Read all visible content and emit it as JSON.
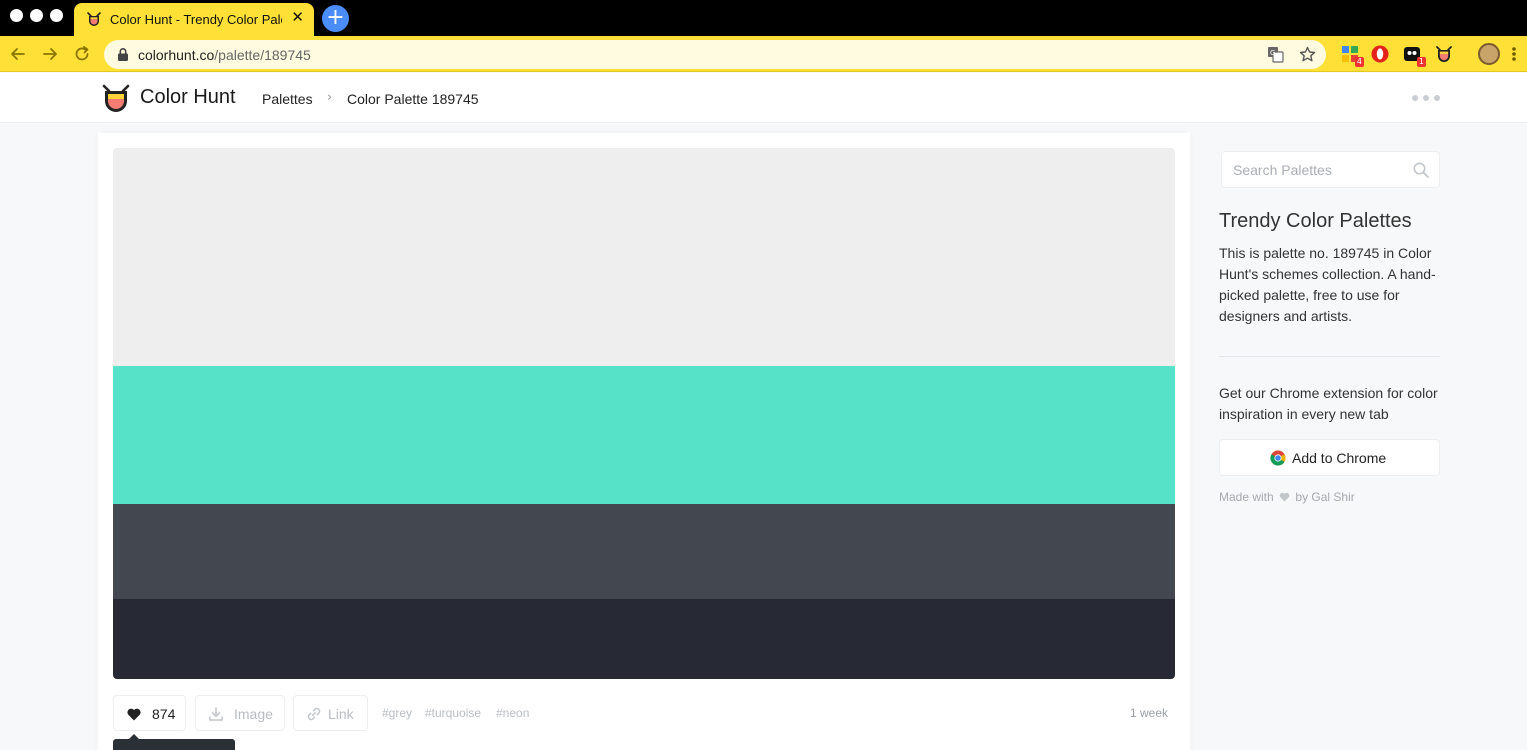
{
  "browser": {
    "tab_title": "Color Hunt - Trendy Color Palettes",
    "tab_close": "✕",
    "new_tab": "+",
    "url_host": "colorhunt.co",
    "url_path": "/palette/189745",
    "extensions": [
      {
        "name": "extension-1",
        "badge": "4"
      },
      {
        "name": "opera-adblock",
        "badge": ""
      },
      {
        "name": "extension-3",
        "badge": "1"
      },
      {
        "name": "color-hunt-extension",
        "badge": ""
      }
    ]
  },
  "header": {
    "logo_text": "Color Hunt",
    "breadcrumb": {
      "palettes": "Palettes",
      "separator": "›",
      "current": "Color Palette 189745"
    }
  },
  "palette": {
    "colors": [
      "#eeeeee",
      "#55e2c8",
      "#434850",
      "#272a35"
    ]
  },
  "actions": {
    "likes": "874",
    "image_label": "Image",
    "link_label": "Link",
    "tags": [
      "#grey",
      "#turquoise",
      "#neon"
    ],
    "age": "1 week"
  },
  "sidebar": {
    "search_placeholder": "Search Palettes",
    "title": "Trendy Color Palettes",
    "description": "This is palette no. 189745 in Color Hunt's schemes collection. A hand-picked palette, free to use for designers and artists.",
    "extension_text": "Get our Chrome extension for color inspiration in every new tab",
    "add_to_chrome": "Add to Chrome",
    "made_with_prefix": "Made with",
    "made_with_suffix": "by Gal Shir"
  },
  "colors": {
    "brand_yellow": "#ffe036",
    "accent_blue": "#4a8df8"
  }
}
